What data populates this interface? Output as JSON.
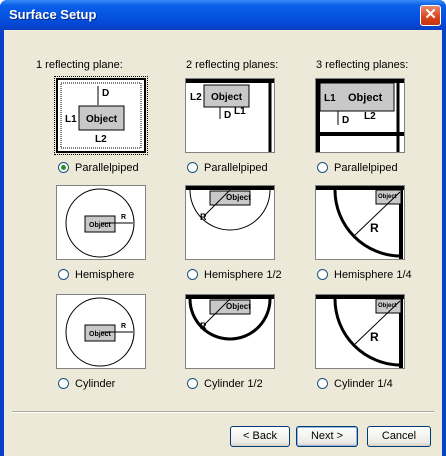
{
  "window": {
    "title": "Surface Setup",
    "close_glyph": "✕"
  },
  "columns": {
    "c1": {
      "heading": "1 reflecting plane:"
    },
    "c2": {
      "heading": "2 reflecting planes:"
    },
    "c3": {
      "heading": "3 reflecting planes:"
    }
  },
  "options": {
    "para1": {
      "label": "Parallelpiped",
      "selected": true
    },
    "para2": {
      "label": "Parallelpiped",
      "selected": false
    },
    "para3": {
      "label": "Parallelpiped",
      "selected": false
    },
    "hemi1": {
      "label": "Hemisphere",
      "selected": false
    },
    "hemi2": {
      "label": "Hemisphere 1/2",
      "selected": false
    },
    "hemi3": {
      "label": "Hemisphere 1/4",
      "selected": false
    },
    "cyl1": {
      "label": "Cylinder",
      "selected": false
    },
    "cyl2": {
      "label": "Cylinder 1/2",
      "selected": false
    },
    "cyl3": {
      "label": "Cylinder 1/4",
      "selected": false
    }
  },
  "diagram_labels": {
    "object": "Object",
    "l1": "L1",
    "l2": "L2",
    "d": "D",
    "r": "R"
  },
  "buttons": {
    "back": "< Back",
    "next": "Next >",
    "cancel": "Cancel"
  }
}
